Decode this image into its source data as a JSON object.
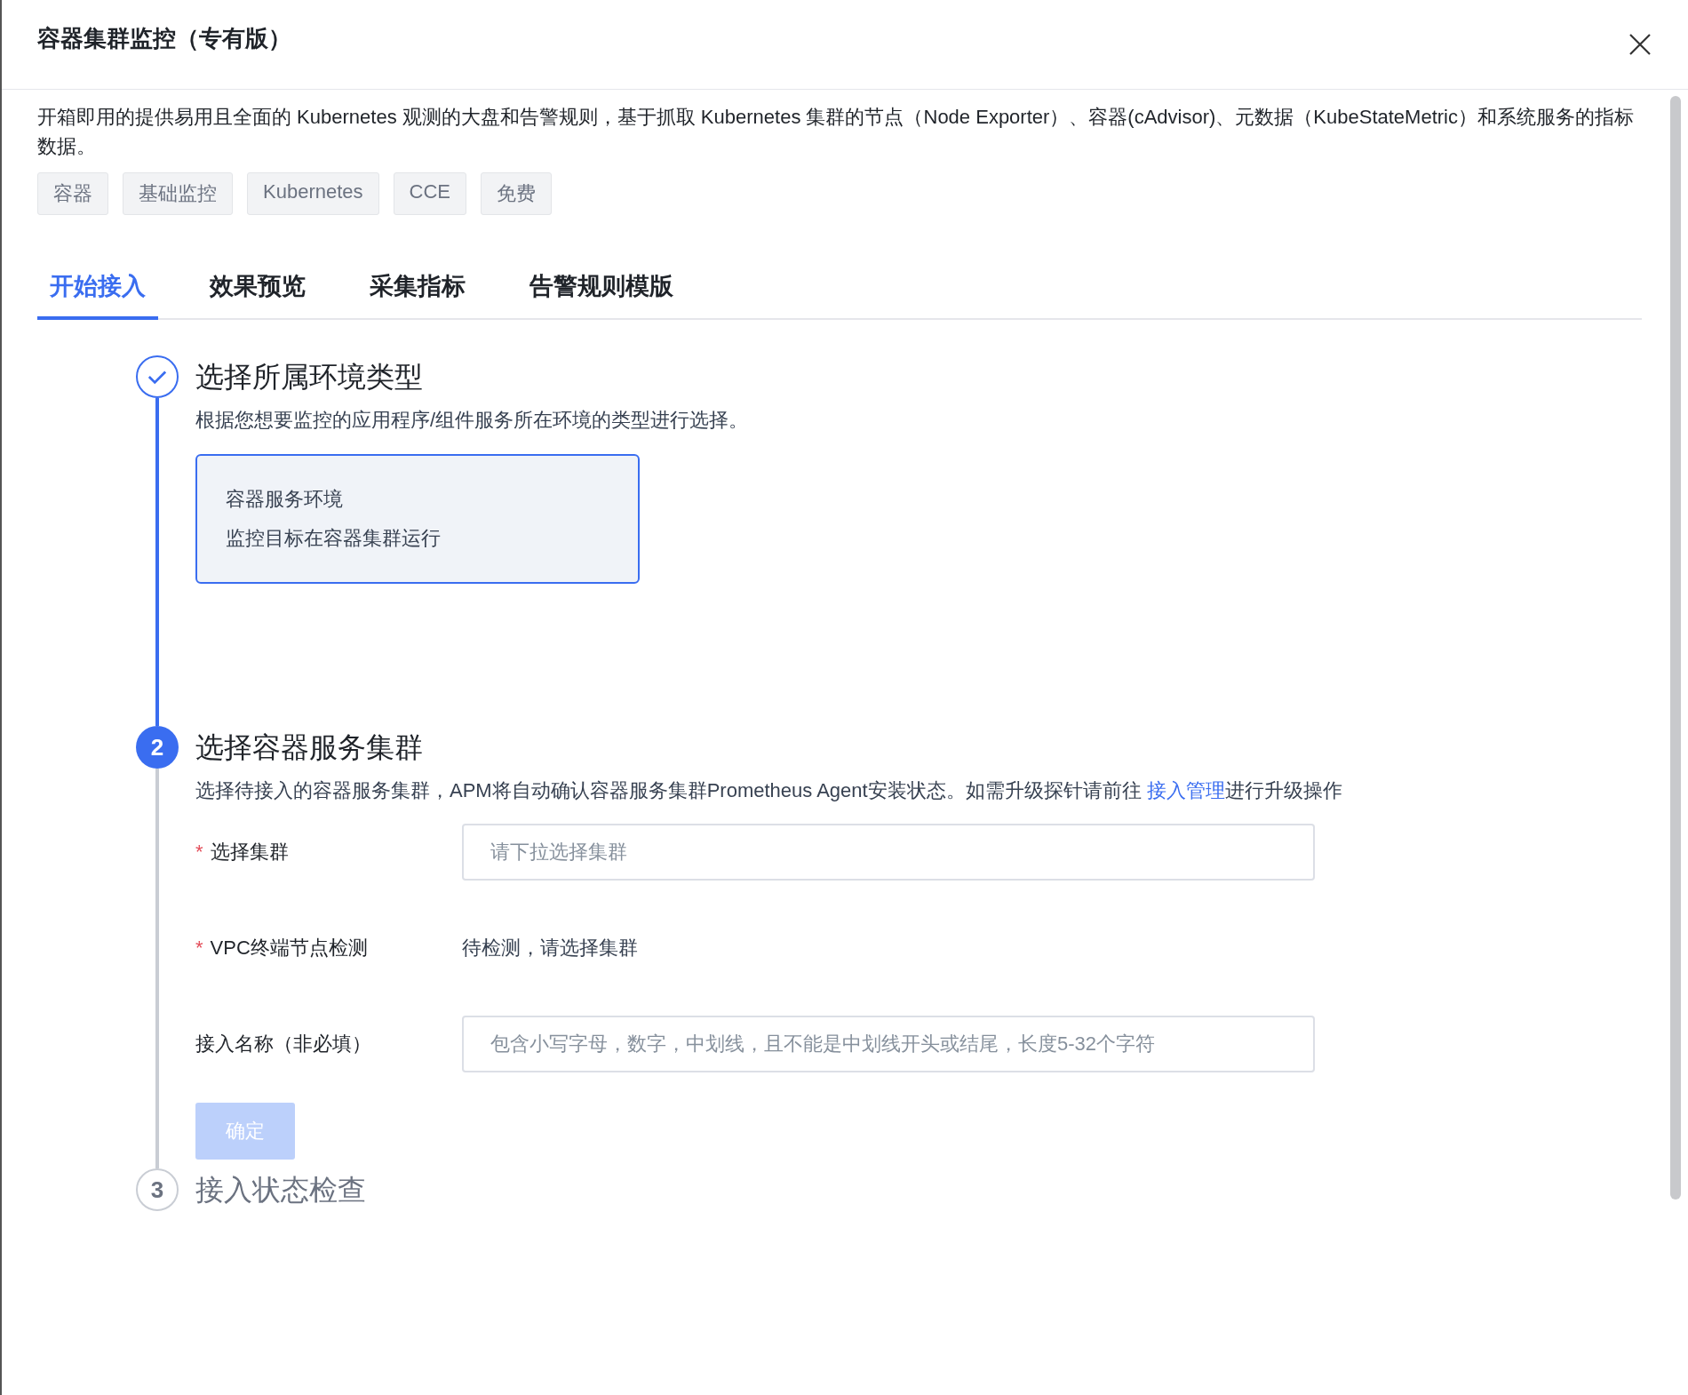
{
  "dialog": {
    "title": "容器集群监控（专有版）"
  },
  "description": "开箱即用的提供易用且全面的 Kubernetes 观测的大盘和告警规则，基于抓取 Kubernetes 集群的节点（Node Exporter）、容器(cAdvisor)、元数据（KubeStateMetric）和系统服务的指标数据。",
  "tags": [
    "容器",
    "基础监控",
    "Kubernetes",
    "CCE",
    "免费"
  ],
  "tabs": [
    {
      "label": "开始接入",
      "selected": true
    },
    {
      "label": "效果预览",
      "selected": false
    },
    {
      "label": "采集指标",
      "selected": false
    },
    {
      "label": "告警规则模版",
      "selected": false
    }
  ],
  "steps": [
    {
      "kind": "done",
      "title": "选择所属环境类型",
      "description": "根据您想要监控的应用程序/组件服务所在环境的类型进行选择。",
      "options": [
        {
          "title": "容器服务环境",
          "subtitle": "监控目标在容器集群运行",
          "selected": true
        }
      ]
    },
    {
      "kind": "active",
      "number": "2",
      "title": "选择容器服务集群",
      "description": "选择待接入的容器服务集群，APM将自动确认容器服务集群Prometheus Agent安装状态。如需升级探针请前往 ",
      "link": "接入管理",
      "description_suffix": "进行升级操作",
      "form": [
        {
          "kind": "select",
          "label": "选择集群",
          "required_mark": "*",
          "placeholder": "请下拉选择集群"
        },
        {
          "kind": "text",
          "label": "VPC终端节点检测",
          "required_mark": "*",
          "value": "待检测，请选择集群"
        },
        {
          "kind": "input",
          "label": "接入名称（非必填）",
          "placeholder": "包含小写字母，数字，中划线，且不能是中划线开头或结尾，长度5-32个字符"
        }
      ],
      "confirm_button": {
        "label": "确定",
        "disabled": true
      }
    },
    {
      "kind": "waiting",
      "number": "3",
      "title": "接入状态检查"
    }
  ]
}
